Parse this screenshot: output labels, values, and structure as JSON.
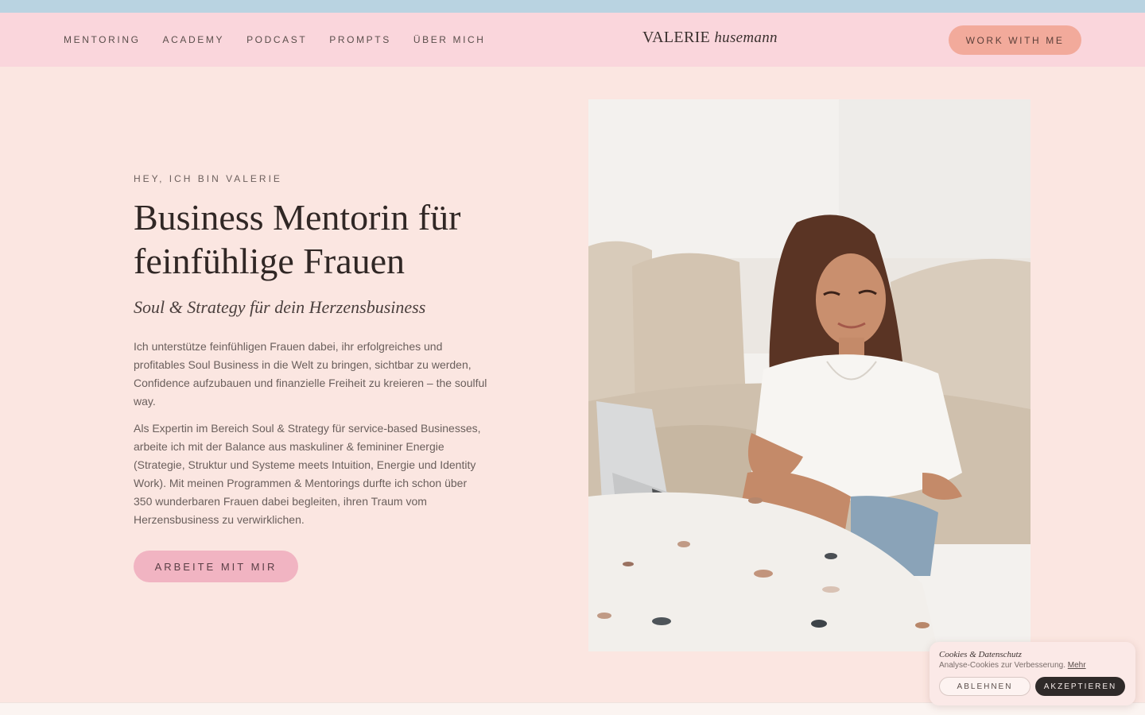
{
  "nav": {
    "items": [
      {
        "label": "MENTORING"
      },
      {
        "label": "ACADEMY"
      },
      {
        "label": "PODCAST"
      },
      {
        "label": "PROMPTS"
      },
      {
        "label": "ÜBER MICH"
      }
    ]
  },
  "logo": {
    "main": "VALERIE",
    "script": "husemann"
  },
  "header": {
    "cta_label": "WORK WITH ME"
  },
  "hero": {
    "eyebrow": "HEY, ICH BIN VALERIE",
    "headline": "Business Mentorin für feinfühlige Frauen",
    "subhead": "Soul & Strategy für dein Herzensbusiness",
    "paragraph_1": "Ich unterstütze feinfühligen Frauen dabei, ihr erfolgreiches und profitables Soul Business in die Welt zu bringen, sichtbar zu werden, Confidence aufzubauen und finanzielle Freiheit zu kreieren – the soulful way.",
    "paragraph_2": "Als Expertin im Bereich Soul & Strategy für service-based Businesses, arbeite ich mit der Balance aus maskuliner & femininer Energie (Strategie, Struktur und Systeme meets Intuition, Energie und Identity Work). Mit meinen Programmen & Mentorings durfte ich schon über 350 wunderbaren Frauen dabei begleiten, ihren Traum vom Herzensbusiness zu verwirklichen.",
    "cta_label": "ARBEITE MIT MIR"
  },
  "cookie": {
    "title": "Cookies & Datenschutz",
    "text": "Analyse-Cookies zur Verbesserung.",
    "more_label": "Mehr",
    "decline_label": "ABLEHNEN",
    "accept_label": "AKZEPTIEREN"
  },
  "colors": {
    "top_strip": "#b9d3e1",
    "header_bg": "#fad6dc",
    "page_bg": "#fbe6e1",
    "header_cta": "#f2aa9b",
    "hero_cta": "#f1b4c2",
    "accept_button": "#2f2a29"
  }
}
